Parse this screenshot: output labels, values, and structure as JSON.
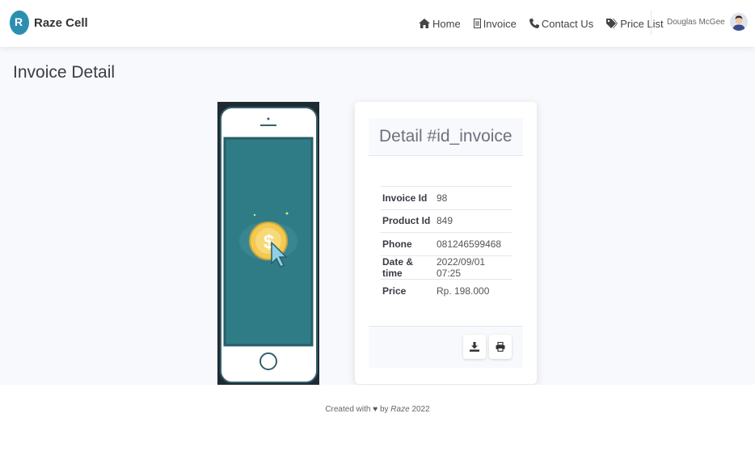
{
  "brand": {
    "name": "Raze Cell"
  },
  "nav": {
    "home": "Home",
    "invoice": "Invoice",
    "contact": "Contact Us",
    "price_list": "Price List"
  },
  "user": {
    "name": "Douglas McGee"
  },
  "page": {
    "title": "Invoice Detail"
  },
  "card": {
    "title": "Detail #id_invoice",
    "rows": [
      {
        "label": "Invoice Id",
        "value": "98"
      },
      {
        "label": "Product Id",
        "value": "849"
      },
      {
        "label": "Phone",
        "value": "081246599468"
      },
      {
        "label": "Date & time",
        "value": "2022/09/01 07:25"
      },
      {
        "label": "Price",
        "value": "Rp. 198.000"
      }
    ]
  },
  "footer": {
    "prefix": "Created with",
    "by": "by",
    "author": "Raze",
    "year": "2022"
  },
  "colors": {
    "accent": "#2c8fb0",
    "screen": "#2f7c87",
    "coin": "#f3c951"
  }
}
